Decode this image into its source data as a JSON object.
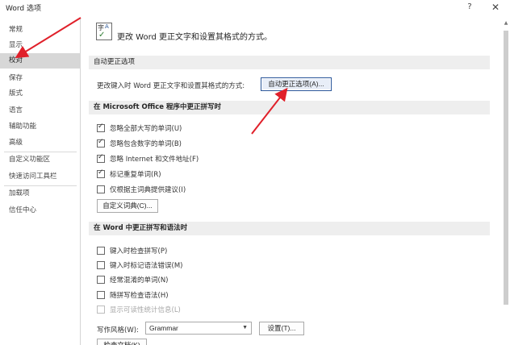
{
  "window": {
    "title": "Word 选项",
    "help_label": "?",
    "close_label": "✕"
  },
  "sidebar": {
    "items": [
      {
        "label": "常规"
      },
      {
        "label": "显示"
      },
      {
        "label": "校对"
      },
      {
        "label": "保存"
      },
      {
        "label": "版式"
      },
      {
        "label": "语言"
      },
      {
        "label": "辅助功能"
      },
      {
        "label": "高级"
      },
      {
        "label": "自定义功能区"
      },
      {
        "label": "快速访问工具栏"
      },
      {
        "label": "加载项"
      },
      {
        "label": "信任中心"
      }
    ],
    "selected": "校对"
  },
  "main": {
    "header_text": "更改 Word 更正文字和设置其格式的方式。",
    "autocorrect": {
      "section_title": "自动更正选项",
      "row_label": "更改键入时 Word 更正文字和设置其格式的方式:",
      "button_label": "自动更正选项(A)..."
    },
    "office": {
      "section_title": "在 Microsoft Office 程序中更正拼写时",
      "options": [
        {
          "label": "忽略全部大写的单词(U)",
          "checked": true
        },
        {
          "label": "忽略包含数字的单词(B)",
          "checked": true
        },
        {
          "label": "忽略 Internet 和文件地址(F)",
          "checked": true
        },
        {
          "label": "标记重复单词(R)",
          "checked": true
        },
        {
          "label": "仅根据主词典提供建议(I)",
          "checked": false
        }
      ],
      "custom_dict_label": "自定义词典(C)..."
    },
    "word": {
      "section_title": "在 Word 中更正拼写和语法时",
      "options": [
        {
          "label": "键入时检查拼写(P)",
          "checked": false,
          "disabled": false
        },
        {
          "label": "键入时标记语法错误(M)",
          "checked": false,
          "disabled": false
        },
        {
          "label": "经常混淆的单词(N)",
          "checked": false,
          "disabled": false
        },
        {
          "label": "随拼写检查语法(H)",
          "checked": false,
          "disabled": false
        },
        {
          "label": "显示可读性统计信息(L)",
          "checked": false,
          "disabled": true
        }
      ],
      "writing_style_label": "写作风格(W):",
      "writing_style_value": "Grammar",
      "settings_label": "设置(T)...",
      "recheck_label": "检查文档(K)"
    }
  },
  "colors": {
    "selected_bg": "#d7d7d7",
    "section_bg": "#eeeeee",
    "accent": "#2b579a",
    "annotation_arrow": "#e0202a"
  }
}
